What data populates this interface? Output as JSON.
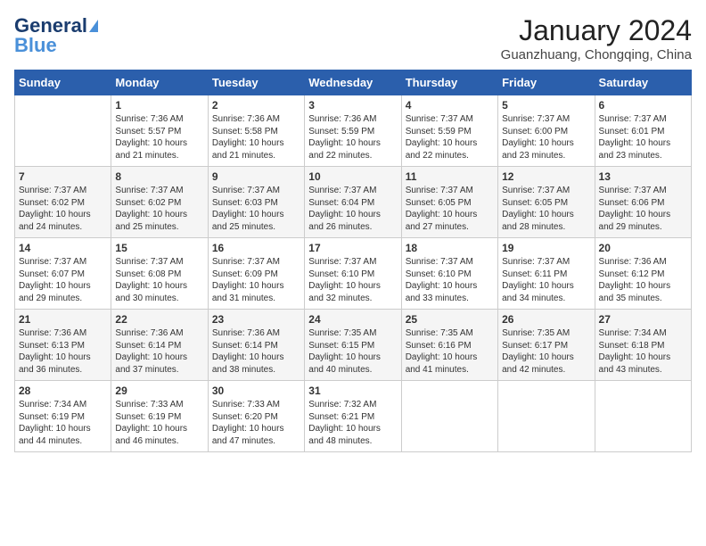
{
  "header": {
    "logo_general": "General",
    "logo_blue": "Blue",
    "month_year": "January 2024",
    "location": "Guanzhuang, Chongqing, China"
  },
  "days_of_week": [
    "Sunday",
    "Monday",
    "Tuesday",
    "Wednesday",
    "Thursday",
    "Friday",
    "Saturday"
  ],
  "weeks": [
    [
      {
        "day": "",
        "content": ""
      },
      {
        "day": "1",
        "content": "Sunrise: 7:36 AM\nSunset: 5:57 PM\nDaylight: 10 hours\nand 21 minutes."
      },
      {
        "day": "2",
        "content": "Sunrise: 7:36 AM\nSunset: 5:58 PM\nDaylight: 10 hours\nand 21 minutes."
      },
      {
        "day": "3",
        "content": "Sunrise: 7:36 AM\nSunset: 5:59 PM\nDaylight: 10 hours\nand 22 minutes."
      },
      {
        "day": "4",
        "content": "Sunrise: 7:37 AM\nSunset: 5:59 PM\nDaylight: 10 hours\nand 22 minutes."
      },
      {
        "day": "5",
        "content": "Sunrise: 7:37 AM\nSunset: 6:00 PM\nDaylight: 10 hours\nand 23 minutes."
      },
      {
        "day": "6",
        "content": "Sunrise: 7:37 AM\nSunset: 6:01 PM\nDaylight: 10 hours\nand 23 minutes."
      }
    ],
    [
      {
        "day": "7",
        "content": "Sunrise: 7:37 AM\nSunset: 6:02 PM\nDaylight: 10 hours\nand 24 minutes."
      },
      {
        "day": "8",
        "content": "Sunrise: 7:37 AM\nSunset: 6:02 PM\nDaylight: 10 hours\nand 25 minutes."
      },
      {
        "day": "9",
        "content": "Sunrise: 7:37 AM\nSunset: 6:03 PM\nDaylight: 10 hours\nand 25 minutes."
      },
      {
        "day": "10",
        "content": "Sunrise: 7:37 AM\nSunset: 6:04 PM\nDaylight: 10 hours\nand 26 minutes."
      },
      {
        "day": "11",
        "content": "Sunrise: 7:37 AM\nSunset: 6:05 PM\nDaylight: 10 hours\nand 27 minutes."
      },
      {
        "day": "12",
        "content": "Sunrise: 7:37 AM\nSunset: 6:05 PM\nDaylight: 10 hours\nand 28 minutes."
      },
      {
        "day": "13",
        "content": "Sunrise: 7:37 AM\nSunset: 6:06 PM\nDaylight: 10 hours\nand 29 minutes."
      }
    ],
    [
      {
        "day": "14",
        "content": "Sunrise: 7:37 AM\nSunset: 6:07 PM\nDaylight: 10 hours\nand 29 minutes."
      },
      {
        "day": "15",
        "content": "Sunrise: 7:37 AM\nSunset: 6:08 PM\nDaylight: 10 hours\nand 30 minutes."
      },
      {
        "day": "16",
        "content": "Sunrise: 7:37 AM\nSunset: 6:09 PM\nDaylight: 10 hours\nand 31 minutes."
      },
      {
        "day": "17",
        "content": "Sunrise: 7:37 AM\nSunset: 6:10 PM\nDaylight: 10 hours\nand 32 minutes."
      },
      {
        "day": "18",
        "content": "Sunrise: 7:37 AM\nSunset: 6:10 PM\nDaylight: 10 hours\nand 33 minutes."
      },
      {
        "day": "19",
        "content": "Sunrise: 7:37 AM\nSunset: 6:11 PM\nDaylight: 10 hours\nand 34 minutes."
      },
      {
        "day": "20",
        "content": "Sunrise: 7:36 AM\nSunset: 6:12 PM\nDaylight: 10 hours\nand 35 minutes."
      }
    ],
    [
      {
        "day": "21",
        "content": "Sunrise: 7:36 AM\nSunset: 6:13 PM\nDaylight: 10 hours\nand 36 minutes."
      },
      {
        "day": "22",
        "content": "Sunrise: 7:36 AM\nSunset: 6:14 PM\nDaylight: 10 hours\nand 37 minutes."
      },
      {
        "day": "23",
        "content": "Sunrise: 7:36 AM\nSunset: 6:14 PM\nDaylight: 10 hours\nand 38 minutes."
      },
      {
        "day": "24",
        "content": "Sunrise: 7:35 AM\nSunset: 6:15 PM\nDaylight: 10 hours\nand 40 minutes."
      },
      {
        "day": "25",
        "content": "Sunrise: 7:35 AM\nSunset: 6:16 PM\nDaylight: 10 hours\nand 41 minutes."
      },
      {
        "day": "26",
        "content": "Sunrise: 7:35 AM\nSunset: 6:17 PM\nDaylight: 10 hours\nand 42 minutes."
      },
      {
        "day": "27",
        "content": "Sunrise: 7:34 AM\nSunset: 6:18 PM\nDaylight: 10 hours\nand 43 minutes."
      }
    ],
    [
      {
        "day": "28",
        "content": "Sunrise: 7:34 AM\nSunset: 6:19 PM\nDaylight: 10 hours\nand 44 minutes."
      },
      {
        "day": "29",
        "content": "Sunrise: 7:33 AM\nSunset: 6:19 PM\nDaylight: 10 hours\nand 46 minutes."
      },
      {
        "day": "30",
        "content": "Sunrise: 7:33 AM\nSunset: 6:20 PM\nDaylight: 10 hours\nand 47 minutes."
      },
      {
        "day": "31",
        "content": "Sunrise: 7:32 AM\nSunset: 6:21 PM\nDaylight: 10 hours\nand 48 minutes."
      },
      {
        "day": "",
        "content": ""
      },
      {
        "day": "",
        "content": ""
      },
      {
        "day": "",
        "content": ""
      }
    ]
  ]
}
